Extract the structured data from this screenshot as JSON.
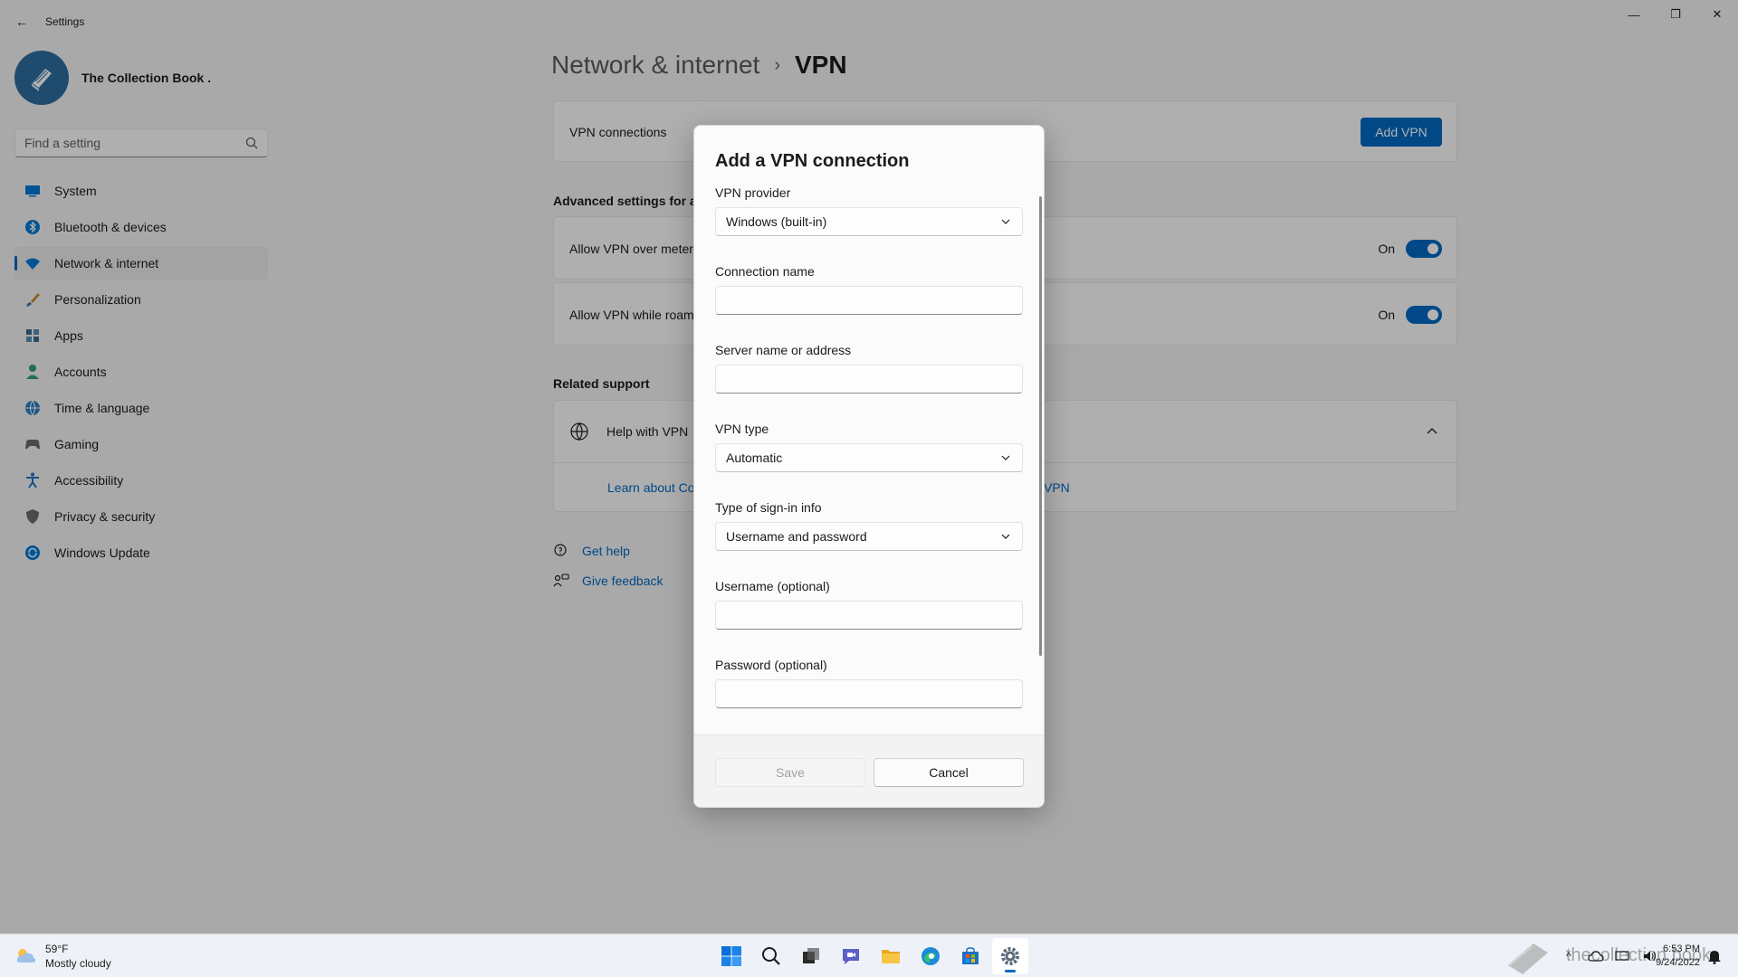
{
  "window": {
    "title": "Settings",
    "back_glyph": "←",
    "minimize_glyph": "—",
    "maximize_glyph": "❐",
    "close_glyph": "✕"
  },
  "profile": {
    "name": "The Collection Book .",
    "icon": "book-icon"
  },
  "search": {
    "placeholder": "Find a setting",
    "icon": "search-icon"
  },
  "sidebar": {
    "items": [
      {
        "label": "System",
        "icon": "system-icon",
        "color": "#0078d4"
      },
      {
        "label": "Bluetooth & devices",
        "icon": "bluetooth-icon",
        "color": "#0078d4"
      },
      {
        "label": "Network & internet",
        "icon": "wifi-icon",
        "color": "#0078d4",
        "active": true
      },
      {
        "label": "Personalization",
        "icon": "brush-icon",
        "color": "#d08a2c"
      },
      {
        "label": "Apps",
        "icon": "apps-icon",
        "color": "#3d6b8a"
      },
      {
        "label": "Accounts",
        "icon": "person-icon",
        "color": "#2ea36b"
      },
      {
        "label": "Time & language",
        "icon": "globe-clock-icon",
        "color": "#2b7bbf"
      },
      {
        "label": "Gaming",
        "icon": "gamepad-icon",
        "color": "#6a6a6a"
      },
      {
        "label": "Accessibility",
        "icon": "accessibility-icon",
        "color": "#1a73c7"
      },
      {
        "label": "Privacy & security",
        "icon": "shield-icon",
        "color": "#6a6a6a"
      },
      {
        "label": "Windows Update",
        "icon": "update-icon",
        "color": "#0078d4"
      }
    ]
  },
  "breadcrumb": {
    "parent": "Network & internet",
    "separator": "›",
    "current": "VPN"
  },
  "main": {
    "vpn_connections_label": "VPN connections",
    "add_vpn_label": "Add VPN",
    "advanced_title": "Advanced settings for al",
    "metered_label": "Allow VPN over metere",
    "metered_state": "On",
    "roaming_label": "Allow VPN while roam",
    "roaming_state": "On",
    "related_title": "Related support",
    "help_vpn_label": "Help with VPN",
    "learn_link_left": "Learn about Co",
    "learn_link_right": "VPN",
    "get_help": "Get help",
    "give_feedback": "Give feedback"
  },
  "dialog": {
    "title": "Add a VPN connection",
    "provider_label": "VPN provider",
    "provider_value": "Windows (built-in)",
    "connection_name_label": "Connection name",
    "connection_name_value": "",
    "server_label": "Server name or address",
    "server_value": "",
    "vpn_type_label": "VPN type",
    "vpn_type_value": "Automatic",
    "signin_label": "Type of sign-in info",
    "signin_value": "Username and password",
    "username_label": "Username (optional)",
    "username_value": "",
    "password_label": "Password (optional)",
    "password_value": "",
    "save_label": "Save",
    "cancel_label": "Cancel"
  },
  "taskbar": {
    "weather_temp": "59°F",
    "weather_desc": "Mostly cloudy",
    "apps": [
      "start-icon",
      "search-icon",
      "task-view-icon",
      "chat-icon",
      "file-explorer-icon",
      "edge-icon",
      "store-icon",
      "settings-icon"
    ],
    "tray_chevron": "^",
    "time": "6:53 PM",
    "date": "9/24/2022",
    "watermark": "thecollection book"
  },
  "colors": {
    "accent": "#0067c0",
    "background": "#f3f3f3",
    "card": "#fbfbfb"
  }
}
